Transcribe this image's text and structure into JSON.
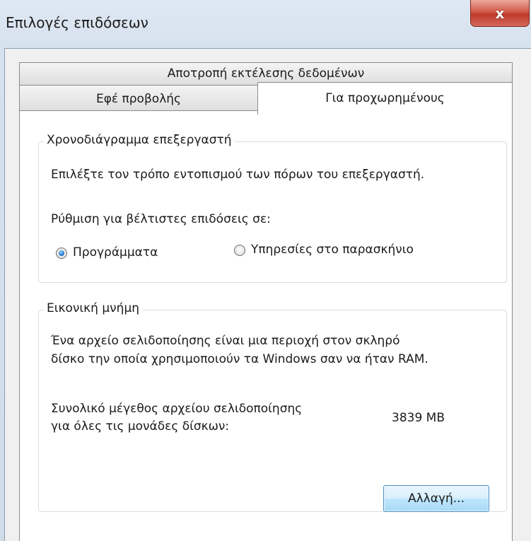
{
  "window": {
    "title": "Επιλογές επιδόσεων",
    "close_glyph": "x"
  },
  "tabs": {
    "back_row": [
      "Αποτροπή εκτέλεσης δεδομένων"
    ],
    "front_row": [
      "Εφέ προβολής",
      "Για προχωρημένους"
    ],
    "active": "Για προχωρημένους"
  },
  "processor_scheduling": {
    "title": "Χρονοδιάγραμμα επεξεργαστή",
    "description": "Επιλέξτε τον τρόπο εντοπισμού των πόρων του επεξεργαστή.",
    "adjust_label": "Ρύθμιση για βέλτιστες επιδόσεις σε:",
    "options": [
      {
        "label": "Προγράμματα",
        "checked": true
      },
      {
        "label": "Υπηρεσίες στο παρασκήνιο",
        "checked": false
      }
    ]
  },
  "virtual_memory": {
    "title": "Εικονική μνήμη",
    "description_line1": "Ένα αρχείο σελιδοποίησης είναι μια περιοχή στον σκληρό",
    "description_line2": "δίσκο την οποία χρησιμοποιούν τα Windows σαν να ήταν RAM.",
    "size_label_line1": "Συνολικό μέγεθος αρχείου σελιδοποίησης",
    "size_label_line2": "για όλες τις μονάδες δίσκων:",
    "size_value": "3839 MB",
    "change_button": "Αλλαγή..."
  },
  "colors": {
    "accent": "#2a7fd6",
    "close_button": "#c74a3a",
    "button_border": "#4f8fc0"
  }
}
